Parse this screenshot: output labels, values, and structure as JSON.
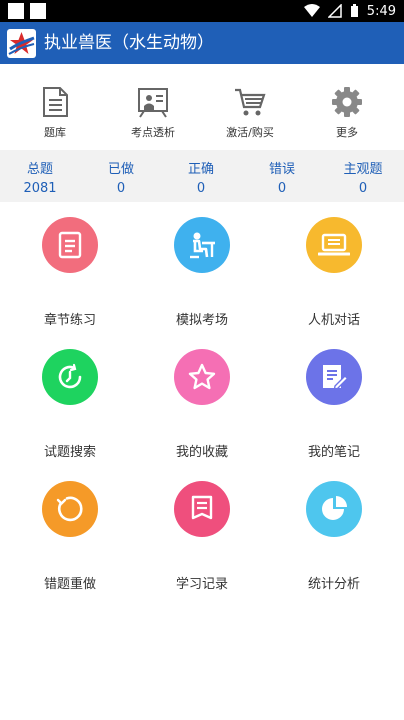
{
  "status_bar": {
    "time": "5:49"
  },
  "app_bar": {
    "title": "执业兽医（水生动物）"
  },
  "toolbar": [
    {
      "label": "题库",
      "icon": "document-icon"
    },
    {
      "label": "考点透析",
      "icon": "whiteboard-icon"
    },
    {
      "label": "激活/购买",
      "icon": "cart-icon"
    },
    {
      "label": "更多",
      "icon": "gear-icon"
    }
  ],
  "stats": [
    {
      "label": "总题",
      "value": "2081"
    },
    {
      "label": "已做",
      "value": "0"
    },
    {
      "label": "正确",
      "value": "0"
    },
    {
      "label": "错误",
      "value": "0"
    },
    {
      "label": "主观题",
      "value": "0"
    }
  ],
  "features": [
    {
      "label": "章节练习",
      "icon": "notebook-icon",
      "color": "#f26d7d"
    },
    {
      "label": "模拟考场",
      "icon": "exam-desk-icon",
      "color": "#3fb1ee"
    },
    {
      "label": "人机对话",
      "icon": "laptop-icon",
      "color": "#f7b92e"
    },
    {
      "label": "试题搜索",
      "icon": "clock-search-icon",
      "color": "#1ed35f"
    },
    {
      "label": "我的收藏",
      "icon": "star-icon",
      "color": "#f56fb4"
    },
    {
      "label": "我的笔记",
      "icon": "note-edit-icon",
      "color": "#6c73e8"
    },
    {
      "label": "错题重做",
      "icon": "redo-icon",
      "color": "#f59a28"
    },
    {
      "label": "学习记录",
      "icon": "record-icon",
      "color": "#ef4f7d"
    },
    {
      "label": "统计分析",
      "icon": "pie-chart-icon",
      "color": "#4ec6ee"
    }
  ]
}
